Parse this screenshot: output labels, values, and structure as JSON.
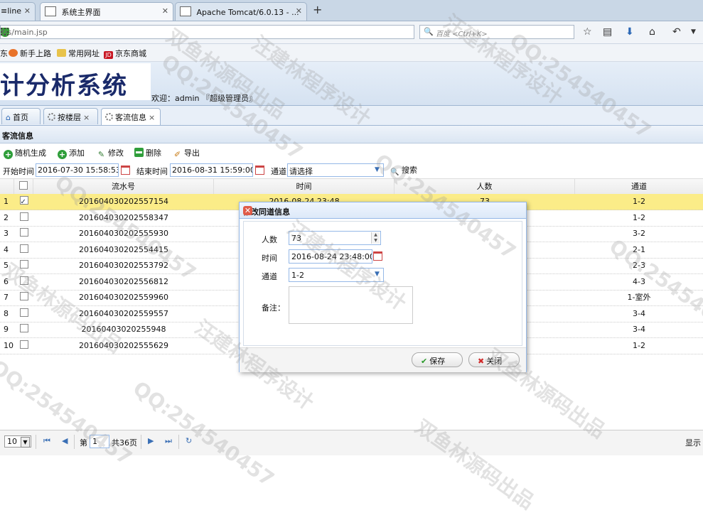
{
  "browser": {
    "tabs": [
      {
        "label": "≡line"
      },
      {
        "label": "系统主界面"
      },
      {
        "label": "Apache Tomcat/6.0.13 - ..."
      }
    ],
    "url": "fss/main.jsp",
    "search_placeholder": "百度 <Ctrl+K>",
    "bookmarks": [
      "新手上路",
      "常用网址",
      "京东商城"
    ],
    "bookmark_prefix": "东"
  },
  "app": {
    "title": "计分析系统",
    "welcome": "欢迎：admin 『超级管理员』",
    "tabs": [
      {
        "label": "首页"
      },
      {
        "label": "按楼层"
      },
      {
        "label": "客流信息"
      }
    ],
    "panel_title": "客流信息",
    "toolbar": {
      "random": "随机生成",
      "add": "添加",
      "edit": "修改",
      "delete": "删除",
      "export": "导出"
    },
    "filter": {
      "start_label": "开始时间",
      "start_value": "2016-07-30 15:58:53",
      "end_label": "结束时间",
      "end_value": "2016-08-31 15:59:00",
      "channel_label": "通道",
      "channel_value": "请选择",
      "search": "搜索"
    },
    "grid": {
      "columns": {
        "serial": "流水号",
        "time": "时间",
        "people": "人数",
        "channel": "通道"
      },
      "rows": [
        {
          "no": "1",
          "serial": "201604030202557154",
          "time": "2016-08-24 23:48",
          "people": "73",
          "channel": "1-2",
          "checked": true
        },
        {
          "no": "2",
          "serial": "201604030202558347",
          "channel": "1-2"
        },
        {
          "no": "3",
          "serial": "201604030202555930",
          "channel": "3-2"
        },
        {
          "no": "4",
          "serial": "201604030202554415",
          "channel": "2-1"
        },
        {
          "no": "5",
          "serial": "201604030202553792",
          "channel": "2-3"
        },
        {
          "no": "6",
          "serial": "201604030202556812",
          "channel": "4-3"
        },
        {
          "no": "7",
          "serial": "201604030202559960",
          "channel": "1-室外"
        },
        {
          "no": "8",
          "serial": "201604030202559557",
          "channel": "3-4"
        },
        {
          "no": "9",
          "serial": "20160403020255948",
          "channel": "3-4"
        },
        {
          "no": "10",
          "serial": "201604030202555629",
          "channel": "1-2"
        }
      ]
    },
    "pager": {
      "page_size": "10",
      "page_label": "第",
      "page_value": "1",
      "total": "共36页",
      "display": "显示"
    }
  },
  "dialog": {
    "title": "修改同道信息",
    "people_label": "人数",
    "people_value": "73",
    "time_label": "时间",
    "time_value": "2016-08-24 23:48:00",
    "channel_label": "通道",
    "channel_value": "1-2",
    "remark_label": "备注：",
    "save": "保存",
    "close": "关闭"
  },
  "watermarks": [
    "汪建林程序设计",
    "QQ:254540457",
    "双鱼林源码出品"
  ]
}
